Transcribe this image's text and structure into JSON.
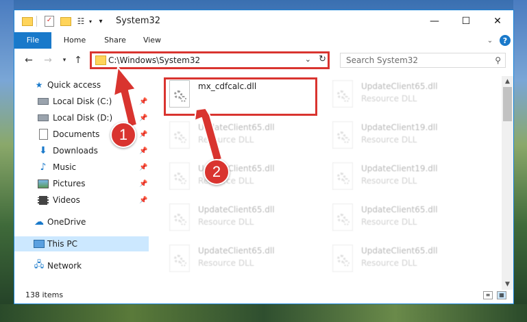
{
  "window": {
    "title": "System32"
  },
  "ribbon": {
    "tabs": [
      "File",
      "Home",
      "Share",
      "View"
    ]
  },
  "nav": {
    "address": "C:\\Windows\\System32",
    "search_placeholder": "Search System32"
  },
  "sidebar": {
    "items": [
      {
        "label": "Quick access",
        "icon": "star-icon",
        "pinned": false
      },
      {
        "label": "Local Disk (C:)",
        "icon": "drive-icon",
        "pinned": true
      },
      {
        "label": "Local Disk (D:)",
        "icon": "drive-icon",
        "pinned": true
      },
      {
        "label": "Documents",
        "icon": "documents-icon",
        "pinned": true
      },
      {
        "label": "Downloads",
        "icon": "download-icon",
        "pinned": true
      },
      {
        "label": "Music",
        "icon": "music-icon",
        "pinned": true
      },
      {
        "label": "Pictures",
        "icon": "pictures-icon",
        "pinned": true
      },
      {
        "label": "Videos",
        "icon": "videos-icon",
        "pinned": true
      },
      {
        "label": "OneDrive",
        "icon": "cloud-icon",
        "pinned": false
      },
      {
        "label": "This PC",
        "icon": "computer-icon",
        "pinned": false,
        "selected": true
      },
      {
        "label": "Network",
        "icon": "network-icon",
        "pinned": false
      }
    ]
  },
  "files": [
    {
      "name": "mx_cdfcalc.dll",
      "type": ""
    },
    {
      "name": "UpdateClient65.dll",
      "type": "Resource DLL"
    },
    {
      "name": "UpdateClient65.dll",
      "type": "Resource DLL"
    },
    {
      "name": "UpdateClient65.dll",
      "type": "Resource DLL"
    },
    {
      "name": "UpdateClient19.dll",
      "type": "Resource DLL"
    },
    {
      "name": "UpdateClient65.dll",
      "type": "Resource DLL"
    },
    {
      "name": "UpdateClient19.dll",
      "type": "Resource DLL"
    },
    {
      "name": "UpdateClient65.dll",
      "type": "Resource DLL"
    },
    {
      "name": "UpdateClient65.dll",
      "type": "Resource DLL"
    },
    {
      "name": "UpdateClient65.dll",
      "type": "Resource DLL"
    },
    {
      "name": "UpdateClient65.dll",
      "type": "Resource DLL"
    }
  ],
  "status": {
    "count": "138 items"
  },
  "callouts": {
    "one": "1",
    "two": "2"
  },
  "colors": {
    "accent": "#1979ca",
    "highlight": "#d9342f",
    "selected": "#cce8ff"
  }
}
